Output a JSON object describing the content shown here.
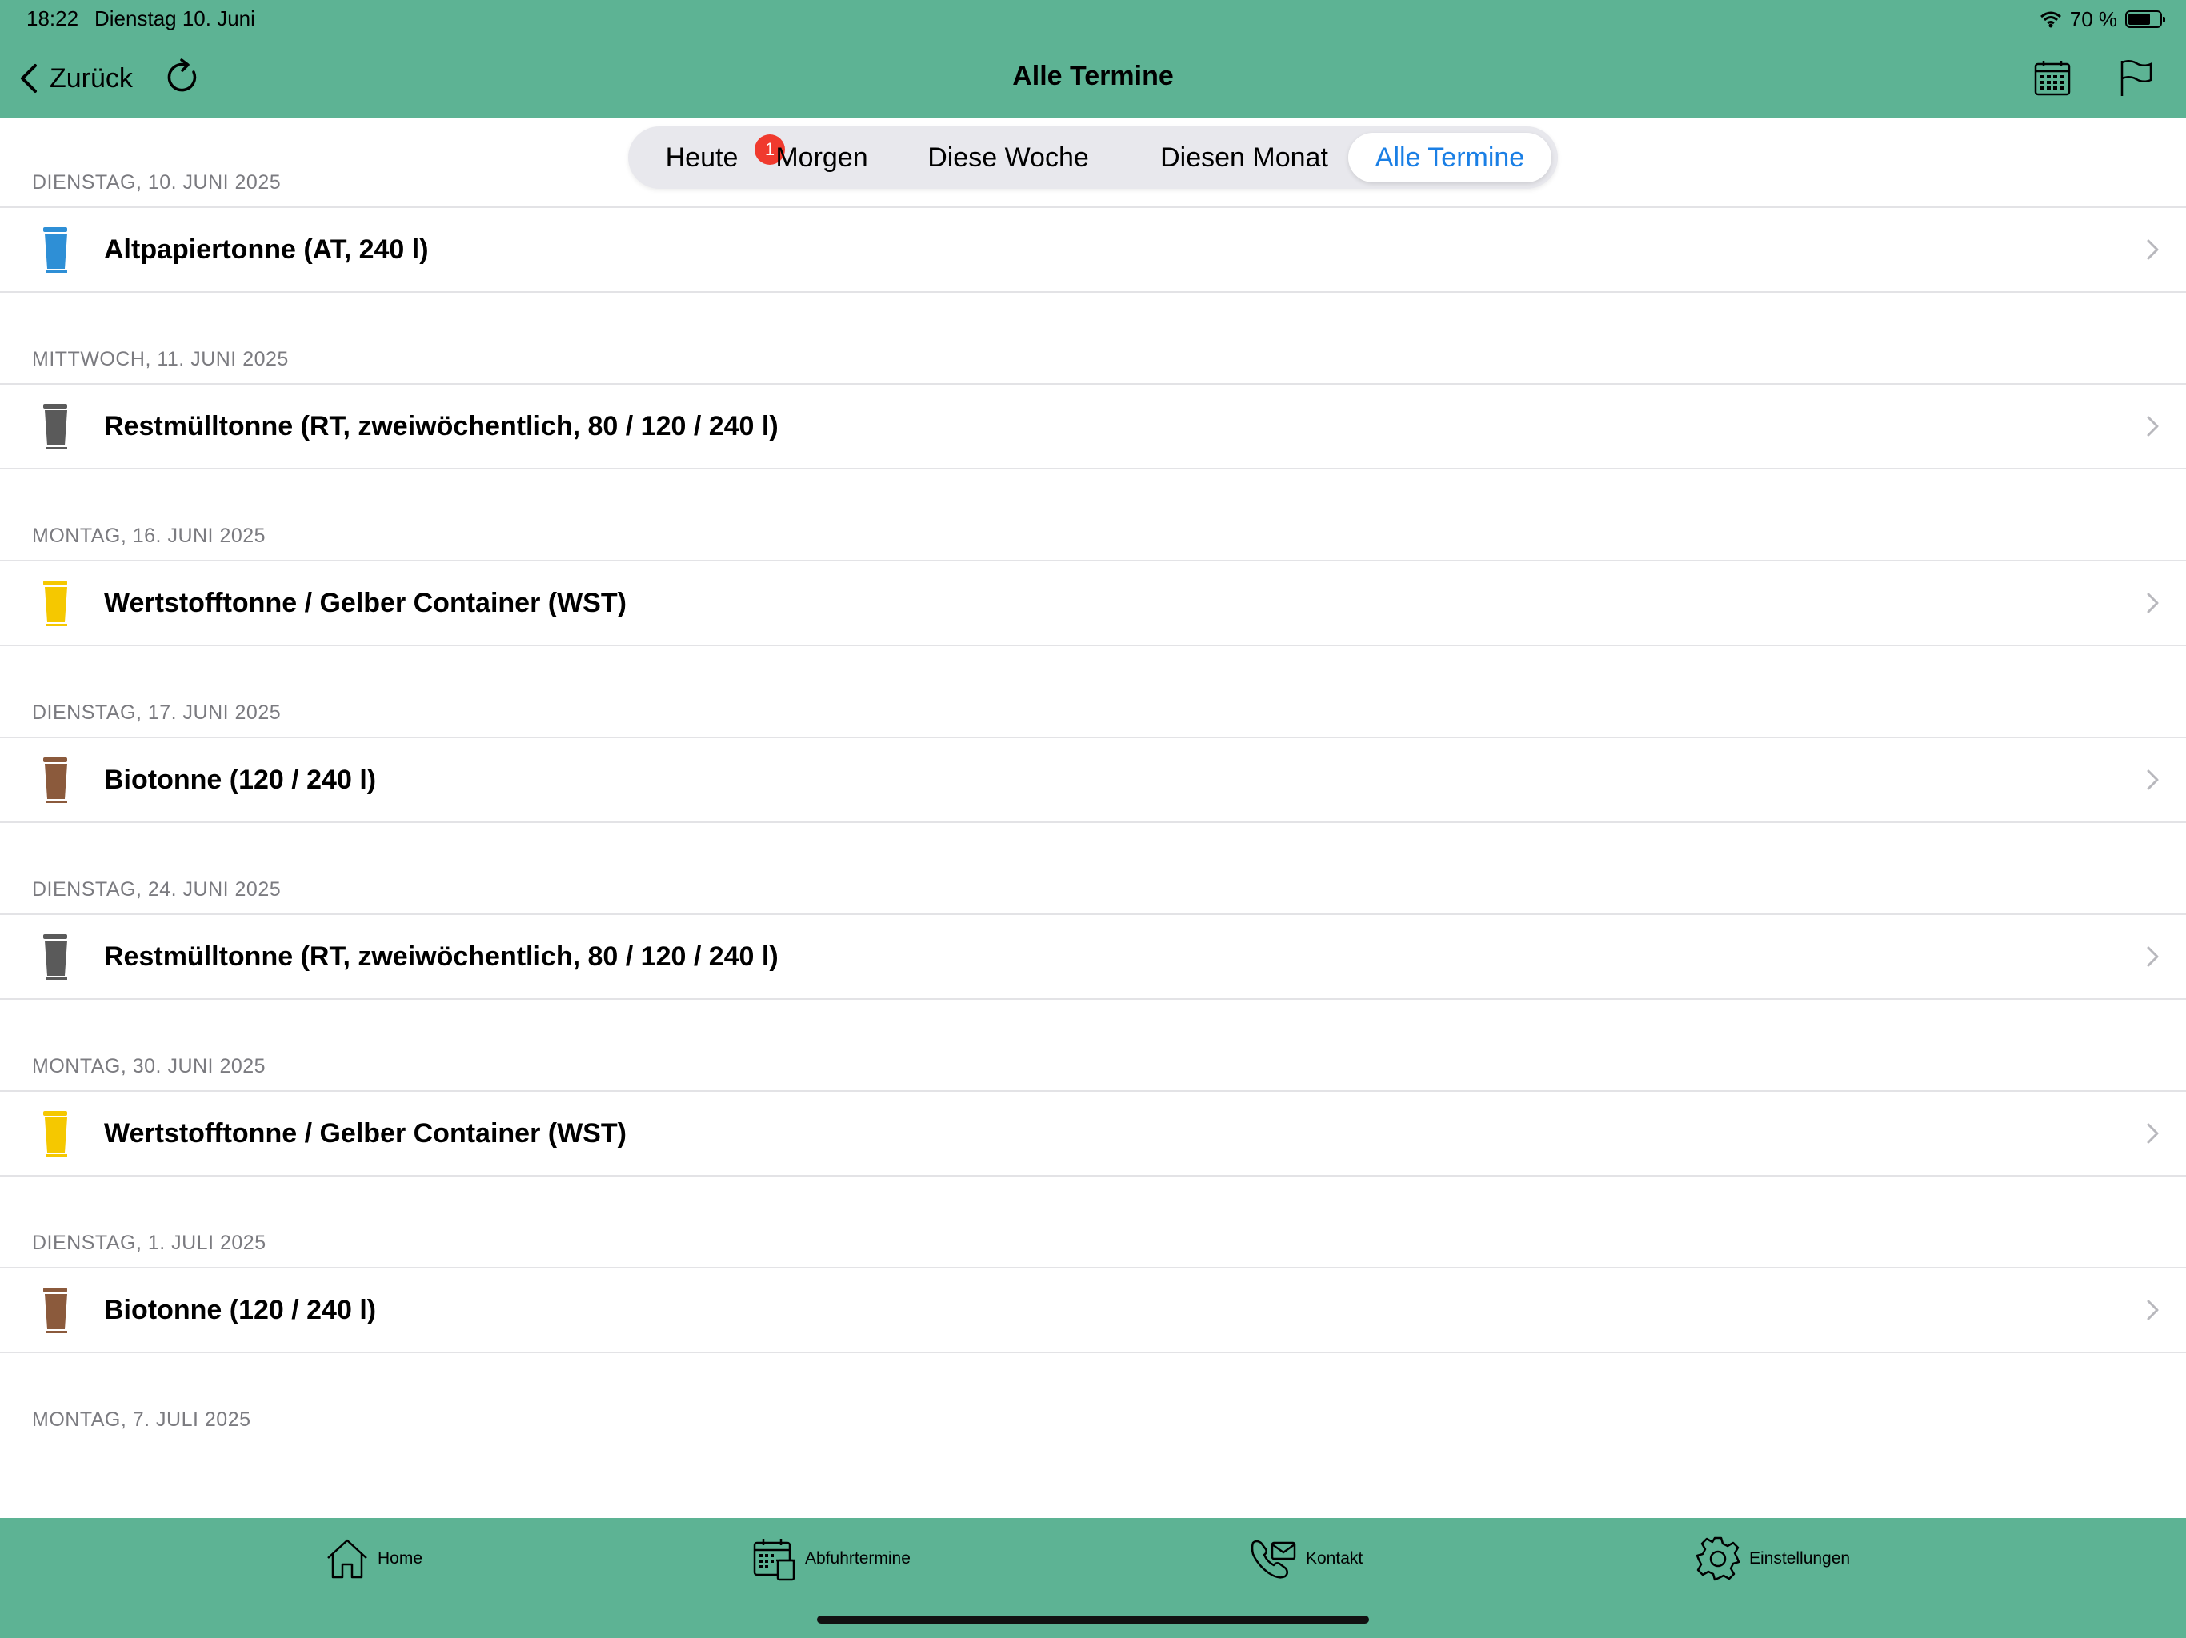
{
  "status_bar": {
    "time": "18:22",
    "date": "Dienstag 10. Juni",
    "battery_text": "70 %",
    "battery_level": 0.7
  },
  "nav": {
    "back_label": "Zurück",
    "title": "Alle Termine",
    "icons": [
      "chevron-left-icon",
      "refresh-icon",
      "calendar-icon",
      "flag-icon"
    ]
  },
  "segments": {
    "items": [
      {
        "label": "Heute",
        "badge": "1"
      },
      {
        "label": "Morgen"
      },
      {
        "label": "Diese Woche"
      },
      {
        "label": "Diesen Monat"
      },
      {
        "label": "Alle Termine",
        "selected": true
      }
    ]
  },
  "sections": [
    {
      "date": "DIENSTAG, 10. JUNI 2025",
      "entry": {
        "label": "Altpapiertonne (AT, 240 l)",
        "bin_color": "#2e8fd6",
        "icon": "blue-bin-icon"
      }
    },
    {
      "date": "MITTWOCH, 11. JUNI 2025",
      "entry": {
        "label": "Restmülltonne (RT, zweiwöchentlich, 80 / 120 / 240 l)",
        "bin_color": "#5a5a5a",
        "icon": "grey-bin-icon"
      }
    },
    {
      "date": "MONTAG, 16. JUNI 2025",
      "entry": {
        "label": "Wertstofftonne / Gelber Container (WST)",
        "bin_color": "#f5c800",
        "icon": "yellow-bin-icon"
      }
    },
    {
      "date": "DIENSTAG, 17. JUNI 2025",
      "entry": {
        "label": "Biotonne (120 / 240 l)",
        "bin_color": "#8b5a3c",
        "icon": "brown-bin-icon"
      }
    },
    {
      "date": "DIENSTAG, 24. JUNI 2025",
      "entry": {
        "label": "Restmülltonne (RT, zweiwöchentlich, 80 / 120 / 240 l)",
        "bin_color": "#5a5a5a",
        "icon": "grey-bin-icon"
      }
    },
    {
      "date": "MONTAG, 30. JUNI 2025",
      "entry": {
        "label": "Wertstofftonne / Gelber Container (WST)",
        "bin_color": "#f5c800",
        "icon": "yellow-bin-icon"
      }
    },
    {
      "date": "DIENSTAG, 1. JULI 2025",
      "entry": {
        "label": "Biotonne (120 / 240 l)",
        "bin_color": "#8b5a3c",
        "icon": "brown-bin-icon"
      }
    },
    {
      "date": "MONTAG, 7. JULI 2025"
    }
  ],
  "tabbar": {
    "items": [
      {
        "label": "Home",
        "icon": "home-icon"
      },
      {
        "label": "Abfuhrtermine",
        "icon": "calendar-bin-icon"
      },
      {
        "label": "Kontakt",
        "icon": "phone-mail-icon"
      },
      {
        "label": "Einstellungen",
        "icon": "gear-icon"
      }
    ]
  },
  "colors": {
    "accent_green": "#5db394",
    "selected_blue": "#1a7fe5",
    "badge_red": "#f03a2e"
  }
}
